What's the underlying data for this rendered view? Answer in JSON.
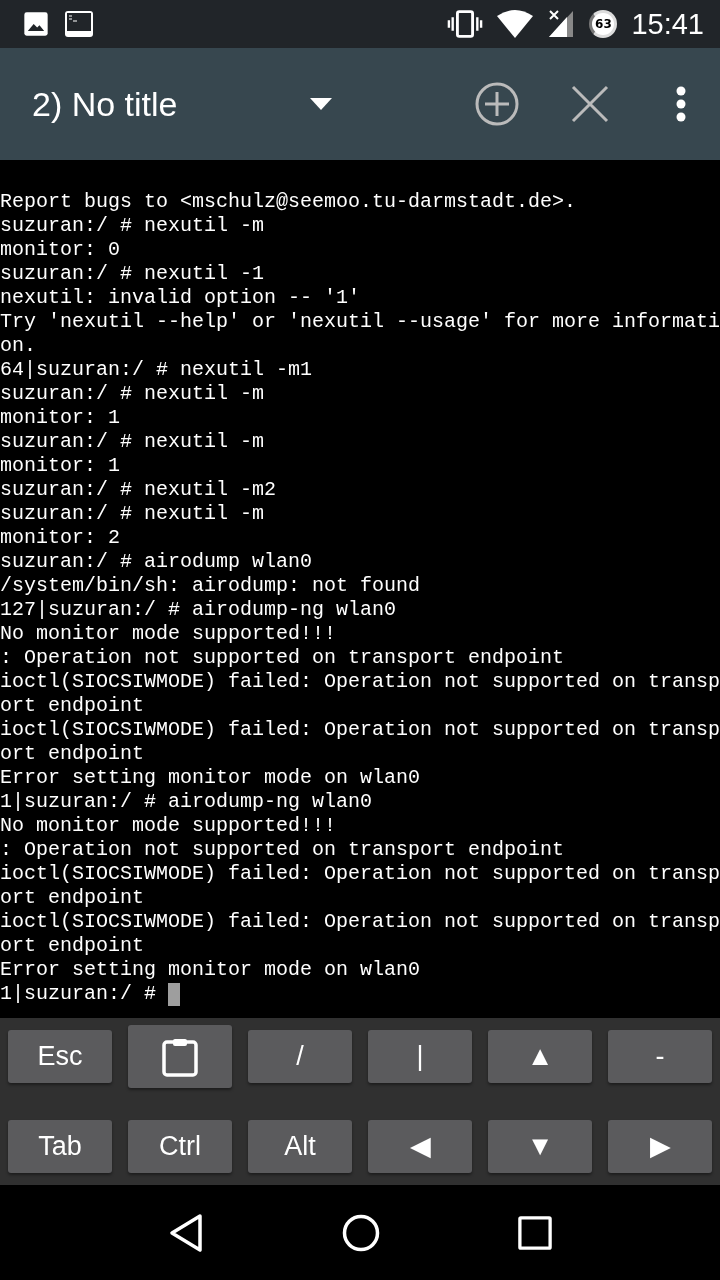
{
  "status_bar": {
    "battery": "63",
    "time": "15:41"
  },
  "toolbar": {
    "title": "2) No title"
  },
  "terminal": {
    "lines": [
      "Report bugs to <mschulz@seemoo.tu-darmstadt.de>.",
      "suzuran:/ # nexutil -m",
      "monitor: 0",
      "suzuran:/ # nexutil -1",
      "nexutil: invalid option -- '1'",
      "Try 'nexutil --help' or 'nexutil --usage' for more informati",
      "on.",
      "64|suzuran:/ # nexutil -m1",
      "suzuran:/ # nexutil -m",
      "monitor: 1",
      "suzuran:/ # nexutil -m",
      "monitor: 1",
      "suzuran:/ # nexutil -m2",
      "suzuran:/ # nexutil -m",
      "monitor: 2",
      "suzuran:/ # airodump wlan0",
      "/system/bin/sh: airodump: not found",
      "127|suzuran:/ # airodump-ng wlan0",
      "No monitor mode supported!!!",
      ": Operation not supported on transport endpoint",
      "ioctl(SIOCSIWMODE) failed: Operation not supported on transp",
      "ort endpoint",
      "ioctl(SIOCSIWMODE) failed: Operation not supported on transp",
      "ort endpoint",
      "Error setting monitor mode on wlan0",
      "1|suzuran:/ # airodump-ng wlan0",
      "No monitor mode supported!!!",
      ": Operation not supported on transport endpoint",
      "ioctl(SIOCSIWMODE) failed: Operation not supported on transp",
      "ort endpoint",
      "ioctl(SIOCSIWMODE) failed: Operation not supported on transp",
      "ort endpoint",
      "Error setting monitor mode on wlan0",
      "1|suzuran:/ # "
    ],
    "cursor": true
  },
  "extra_keys": [
    [
      {
        "kind": "text",
        "label": "Esc"
      },
      {
        "kind": "clipboard"
      },
      {
        "kind": "text",
        "label": "/"
      },
      {
        "kind": "text",
        "label": "|"
      },
      {
        "kind": "text",
        "label": "▲"
      },
      {
        "kind": "text",
        "label": "-"
      }
    ],
    [
      {
        "kind": "text",
        "label": "Tab"
      },
      {
        "kind": "text",
        "label": "Ctrl"
      },
      {
        "kind": "text",
        "label": "Alt"
      },
      {
        "kind": "text",
        "label": "◀"
      },
      {
        "kind": "text",
        "label": "▼"
      },
      {
        "kind": "text",
        "label": "▶"
      }
    ]
  ]
}
